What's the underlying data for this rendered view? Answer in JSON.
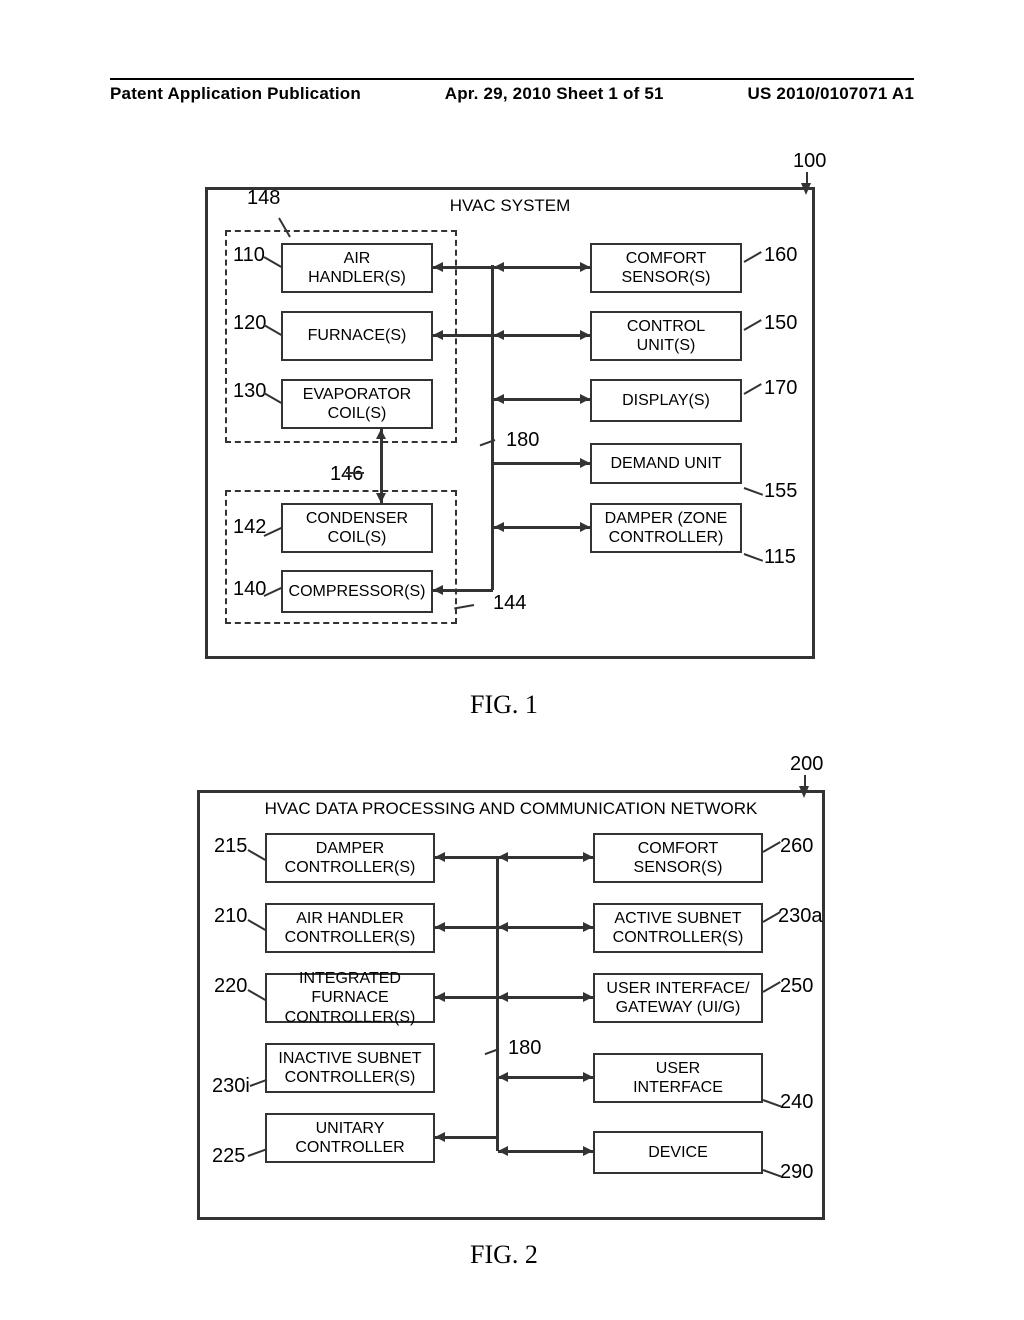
{
  "header": {
    "left": "Patent Application Publication",
    "center": "Apr. 29, 2010  Sheet 1 of 51",
    "right": "US 2010/0107071 A1"
  },
  "fig1": {
    "label": "FIG. 1",
    "title": "HVAC SYSTEM",
    "refnum_system": "100",
    "boxes": {
      "air_handler": "AIR\nHANDLER(S)",
      "furnace": "FURNACE(S)",
      "evaporator": "EVAPORATOR\nCOIL(S)",
      "condenser": "CONDENSER\nCOIL(S)",
      "compressor": "COMPRESSOR(S)",
      "comfort_sensor": "COMFORT\nSENSOR(S)",
      "control_unit": "CONTROL\nUNIT(S)",
      "display": "DISPLAY(S)",
      "demand_unit": "DEMAND UNIT",
      "damper": "DAMPER (ZONE\nCONTROLLER)"
    },
    "refs": {
      "148": "148",
      "110": "110",
      "120": "120",
      "130": "130",
      "142": "142",
      "140": "140",
      "146": "146",
      "180": "180",
      "144": "144",
      "160": "160",
      "150": "150",
      "170": "170",
      "155": "155",
      "115": "115"
    }
  },
  "fig2": {
    "label": "FIG. 2",
    "title": "HVAC DATA PROCESSING AND COMMUNICATION NETWORK",
    "refnum_system": "200",
    "boxes": {
      "damper_ctrl": "DAMPER\nCONTROLLER(S)",
      "airh_ctrl": "AIR HANDLER\nCONTROLLER(S)",
      "int_furn_ctrl": "INTEGRATED FURNACE\nCONTROLLER(S)",
      "inact_subnet": "INACTIVE SUBNET\nCONTROLLER(S)",
      "unitary": "UNITARY\nCONTROLLER",
      "comfort_sensor": "COMFORT\nSENSOR(S)",
      "act_subnet": "ACTIVE SUBNET\nCONTROLLER(S)",
      "uig": "USER INTERFACE/\nGATEWAY (UI/G)",
      "ui": "USER\nINTERFACE",
      "device": "DEVICE"
    },
    "refs": {
      "215": "215",
      "210": "210",
      "220": "220",
      "230i": "230i",
      "225": "225",
      "180": "180",
      "260": "260",
      "230a": "230a",
      "250": "250",
      "240": "240",
      "290": "290"
    }
  }
}
